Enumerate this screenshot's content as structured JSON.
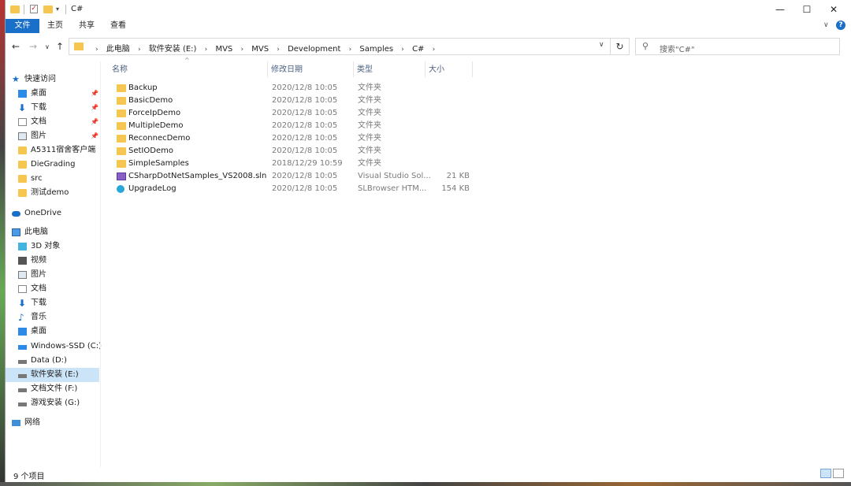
{
  "window": {
    "title": "C#",
    "minimize": "—",
    "maximize": "☐",
    "close": "✕"
  },
  "ribbon": {
    "tabs": [
      "文件",
      "主页",
      "共享",
      "查看"
    ],
    "collapse": "∨",
    "help": "?"
  },
  "nav": {
    "back": "←",
    "forward": "→",
    "recent": "∨",
    "up": "↑",
    "refresh": "↻"
  },
  "address": {
    "crumbs": [
      "此电脑",
      "软件安装 (E:)",
      "MVS",
      "MVS",
      "Development",
      "Samples",
      "C#"
    ]
  },
  "search": {
    "placeholder": "搜索\"C#\""
  },
  "sidebar": {
    "items": [
      {
        "label": "快速访问",
        "icon": "star-icon"
      },
      {
        "label": "桌面",
        "icon": "desktop-icon",
        "pinned": true
      },
      {
        "label": "下载",
        "icon": "download-icon",
        "pinned": true
      },
      {
        "label": "文档",
        "icon": "document-icon",
        "pinned": true
      },
      {
        "label": "图片",
        "icon": "pictures-icon",
        "pinned": true
      },
      {
        "label": "A5311宿舍客户端",
        "icon": "folder-icon"
      },
      {
        "label": "DieGrading",
        "icon": "folder-icon"
      },
      {
        "label": "src",
        "icon": "folder-icon"
      },
      {
        "label": "测试demo",
        "icon": "folder-icon"
      },
      {
        "label": "OneDrive",
        "icon": "cloud-icon"
      },
      {
        "label": "此电脑",
        "icon": "computer-icon"
      },
      {
        "label": "3D 对象",
        "icon": "3d-objects-icon"
      },
      {
        "label": "视频",
        "icon": "video-icon"
      },
      {
        "label": "图片",
        "icon": "pictures-icon"
      },
      {
        "label": "文档",
        "icon": "document-icon"
      },
      {
        "label": "下载",
        "icon": "download-icon"
      },
      {
        "label": "音乐",
        "icon": "music-icon"
      },
      {
        "label": "桌面",
        "icon": "desktop-icon"
      },
      {
        "label": "Windows-SSD (C:)",
        "icon": "windows-drive-icon"
      },
      {
        "label": "Data (D:)",
        "icon": "drive-icon"
      },
      {
        "label": "软件安装 (E:)",
        "icon": "drive-icon",
        "selected": true
      },
      {
        "label": "文档文件 (F:)",
        "icon": "drive-icon"
      },
      {
        "label": "游戏安装 (G:)",
        "icon": "drive-icon"
      },
      {
        "label": "网络",
        "icon": "network-icon"
      }
    ],
    "pin_glyph": "📌"
  },
  "columns": {
    "name": "名称",
    "date": "修改日期",
    "type": "类型",
    "size": "大小",
    "sort_glyph": "^"
  },
  "files": [
    {
      "name": "Backup",
      "date": "2020/12/8 10:05",
      "type": "文件夹",
      "size": "",
      "icon": "folder-icon"
    },
    {
      "name": "BasicDemo",
      "date": "2020/12/8 10:05",
      "type": "文件夹",
      "size": "",
      "icon": "folder-icon"
    },
    {
      "name": "ForceIpDemo",
      "date": "2020/12/8 10:05",
      "type": "文件夹",
      "size": "",
      "icon": "folder-icon"
    },
    {
      "name": "MultipleDemo",
      "date": "2020/12/8 10:05",
      "type": "文件夹",
      "size": "",
      "icon": "folder-icon"
    },
    {
      "name": "ReconnecDemo",
      "date": "2020/12/8 10:05",
      "type": "文件夹",
      "size": "",
      "icon": "folder-icon"
    },
    {
      "name": "SetIODemo",
      "date": "2020/12/8 10:05",
      "type": "文件夹",
      "size": "",
      "icon": "folder-icon"
    },
    {
      "name": "SimpleSamples",
      "date": "2018/12/29 10:59",
      "type": "文件夹",
      "size": "",
      "icon": "folder-icon"
    },
    {
      "name": "CSharpDotNetSamples_VS2008.sln",
      "date": "2020/12/8 10:05",
      "type": "Visual Studio Sol...",
      "size": "21 KB",
      "icon": "solution-file-icon"
    },
    {
      "name": "UpgradeLog",
      "date": "2020/12/8 10:05",
      "type": "SLBrowser HTM...",
      "size": "154 KB",
      "icon": "html-file-icon"
    }
  ],
  "status": {
    "count": "9 个项目"
  }
}
